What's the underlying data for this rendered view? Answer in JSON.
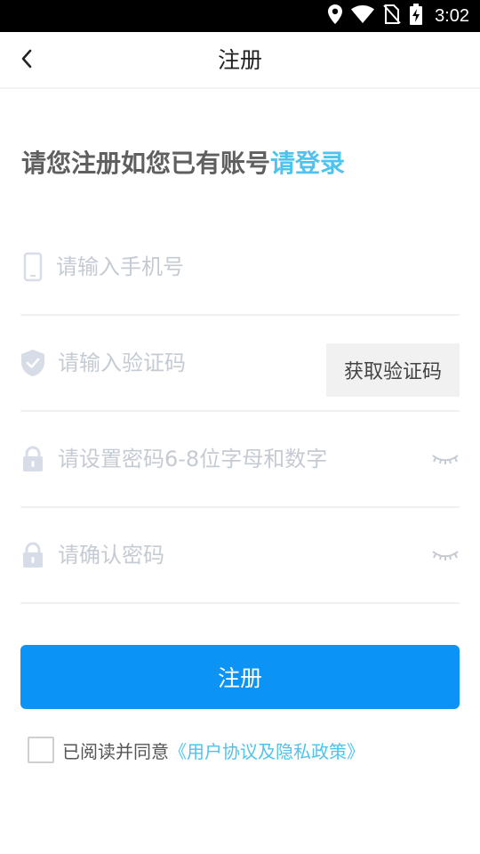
{
  "status_bar": {
    "time": "3:02",
    "icons": [
      "location-icon",
      "wifi-icon",
      "no-sim-icon",
      "battery-charging-icon"
    ]
  },
  "header": {
    "title": "注册",
    "back_icon": "chevron-left-icon"
  },
  "welcome": {
    "text": "请您注册如您已有账号",
    "login_link": "请登录"
  },
  "form": {
    "phone": {
      "placeholder": "请输入手机号",
      "icon": "phone-icon"
    },
    "code": {
      "placeholder": "请输入验证码",
      "icon": "shield-check-icon",
      "button_label": "获取验证码"
    },
    "password": {
      "placeholder": "请设置密码6-8位字母和数字",
      "icon": "lock-icon",
      "toggle_icon": "eye-closed-icon"
    },
    "confirm": {
      "placeholder": "请确认密码",
      "icon": "lock-icon",
      "toggle_icon": "eye-closed-icon"
    }
  },
  "register_button": "注册",
  "agreement": {
    "text": "已阅读并同意",
    "link": "《用户协议及隐私政策》"
  },
  "colors": {
    "primary": "#0b93f6",
    "link": "#4fc3ee",
    "placeholder": "#c5cbd3",
    "icon": "#d6dde6"
  }
}
